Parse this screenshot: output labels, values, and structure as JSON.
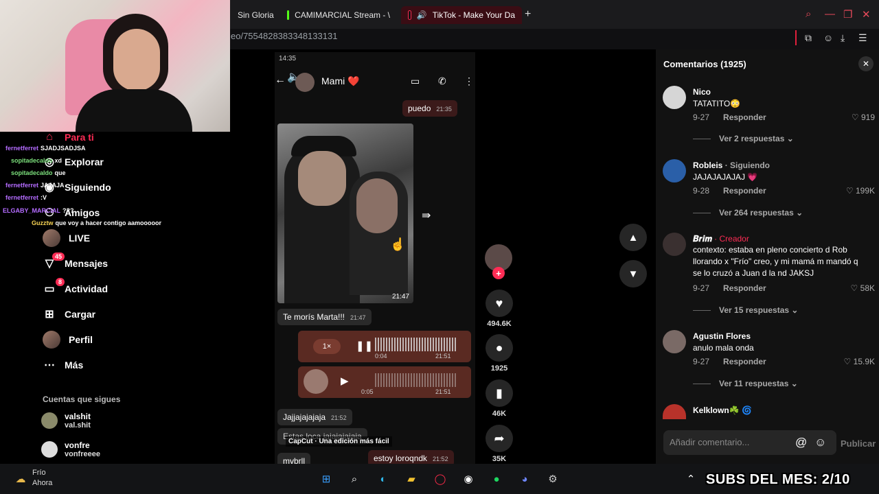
{
  "browser": {
    "tabs": [
      {
        "label": "Sin Gloria"
      },
      {
        "label": "CAMIMARCIAL Stream - \\"
      },
      {
        "label": "TikTok - Make Your Da"
      }
    ],
    "new_tab": "+",
    "url": "eo/7554828383348133131"
  },
  "nav": {
    "items": [
      {
        "label": "Para ti"
      },
      {
        "label": "Explorar"
      },
      {
        "label": "Siguiendo"
      },
      {
        "label": "Amigos"
      },
      {
        "label": "LIVE"
      },
      {
        "label": "Mensajes",
        "badge": "45"
      },
      {
        "label": "Actividad",
        "badge": "8"
      },
      {
        "label": "Cargar"
      },
      {
        "label": "Perfil"
      },
      {
        "label": "Más"
      }
    ],
    "following_title": "Cuentas que sigues",
    "following": [
      {
        "name": "valshit",
        "handle": "val.shit"
      },
      {
        "name": "vonfre",
        "handle": "vonfreeee"
      }
    ]
  },
  "chat": [
    {
      "user": "fernetferret",
      "msg": "SJADJSADJSA"
    },
    {
      "user": "sopitadecaldo",
      "msg": "xd"
    },
    {
      "user": "sopitadecaldo",
      "msg": "que"
    },
    {
      "user": "fernetferret",
      "msg": "JAJAJA"
    },
    {
      "user": "fernetferret",
      "msg": ":V"
    },
    {
      "user": "ELGABY_MARCIAL",
      "msg": "???"
    },
    {
      "user": "Guzztw",
      "msg": "que voy a hacer contigo aamooooor"
    }
  ],
  "video": {
    "status": "14:35",
    "contact": "Mami ❤️",
    "messages": {
      "m1": "puedo",
      "m1_time": "21:35",
      "photo_time": "21:47",
      "m2": "Te morís Marta!!!",
      "m2_time": "21:47",
      "audio1_speed": "1×",
      "audio1_pos": "0:04",
      "audio1_time": "21:51",
      "audio2_pos": "0:05",
      "audio2_time": "21:51",
      "m3": "Jajjajajajaja",
      "m3_time": "21:52",
      "m4": "Estas loca jajajajajaja",
      "m5": "mvbrll",
      "m6": "estoy loroqndk",
      "m6_time": "21:52"
    },
    "capcut": "CapCut · Una edición más fácil"
  },
  "actions": {
    "likes": "494.6K",
    "comments": "1925",
    "saves": "46K",
    "shares": "35K"
  },
  "comments": {
    "title": "Comentarios (1925)",
    "items": [
      {
        "name": "Nico",
        "text": "TATATITO😳",
        "date": "9-27",
        "reply": "Responder",
        "likes": "919",
        "more": "Ver 2 respuestas"
      },
      {
        "name": "Robleis",
        "extra": "· Siguiendo",
        "text": "JAJAJAJAJAJ 💗",
        "date": "9-28",
        "reply": "Responder",
        "likes": "199K",
        "more": "Ver 264 respuestas"
      },
      {
        "name": "𝑩𝒓𝒊𝒎",
        "creator": "· Creador",
        "text": "contexto: estaba en pleno concierto d Rob llorando x \"Frío\" creo, y mi mamá m mandó q se lo cruzó a Juan d la nd JAKSJ",
        "date": "9-27",
        "reply": "Responder",
        "likes": "58K",
        "more": "Ver 15 respuestas"
      },
      {
        "name": "Agustin Flores",
        "text": "anulo mala onda",
        "date": "9-27",
        "reply": "Responder",
        "likes": "15.9K",
        "more": "Ver 11 respuestas"
      },
      {
        "name": "Kelklown☘️ 🌀",
        "text": "",
        "date": "",
        "reply": "",
        "likes": "",
        "more": ""
      }
    ],
    "input_placeholder": "Añadir comentario...",
    "publish": "Publicar"
  },
  "taskbar": {
    "weather_temp": "Frío",
    "weather_sub": "Ahora",
    "subs_banner": "SUBS DEL MES: 2/10"
  },
  "colors": {
    "accent": "#fe2c55",
    "panel": "#121212",
    "bg": "#000000"
  }
}
